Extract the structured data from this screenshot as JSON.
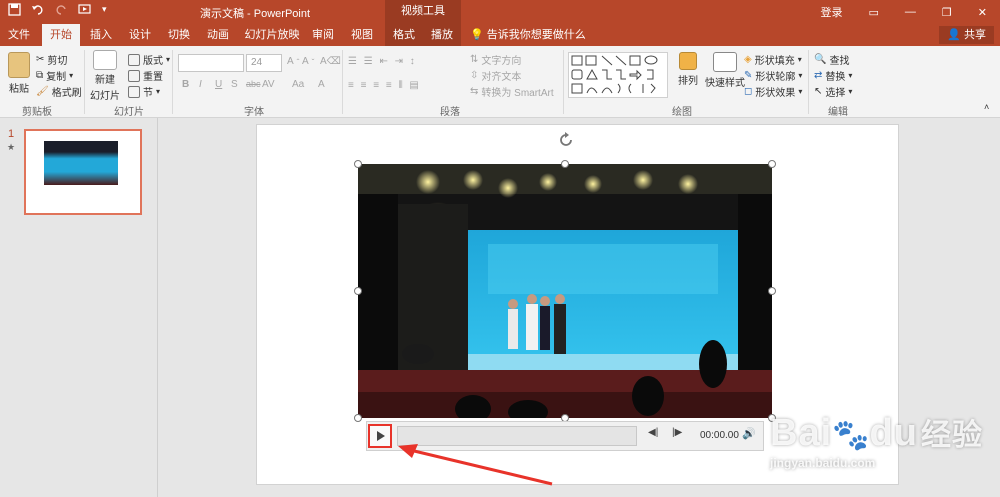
{
  "title_bar": {
    "doc_title": "演示文稿 - PowerPoint",
    "context_tools": "视频工具",
    "login": "登录",
    "window_controls": [
      "ribbon-display-icon",
      "minimize-icon",
      "restore-icon",
      "close-icon"
    ]
  },
  "tabs": [
    {
      "label": "文件"
    },
    {
      "label": "开始"
    },
    {
      "label": "插入"
    },
    {
      "label": "设计"
    },
    {
      "label": "切换"
    },
    {
      "label": "动画"
    },
    {
      "label": "幻灯片放映"
    },
    {
      "label": "审阅"
    },
    {
      "label": "视图"
    },
    {
      "label": "格式"
    },
    {
      "label": "播放"
    }
  ],
  "active_tab": "开始",
  "tell_me": "告诉我你想要做什么",
  "share": "共享",
  "ribbon": {
    "clipboard": {
      "paste": "粘贴",
      "cut": "剪切",
      "copy": "复制",
      "format_painter": "格式刷",
      "label": "剪贴板"
    },
    "slides": {
      "new_slide": "新建",
      "new_slide2": "幻灯片",
      "layout": "版式",
      "reset": "重置",
      "section": "节",
      "label": "幻灯片"
    },
    "font": {
      "size": "24",
      "label": "字体",
      "bold": "B",
      "italic": "I",
      "underline": "U",
      "strike": "S",
      "abc": "abc",
      "av": "AV",
      "aa": "Aa",
      "a_color": "A"
    },
    "paragraph": {
      "text_direction": "文字方向",
      "align_text": "对齐文本",
      "smartart": "转换为 SmartArt",
      "label": "段落"
    },
    "drawing": {
      "arrange": "排列",
      "quick_styles": "快速样式",
      "shape_fill": "形状填充",
      "shape_outline": "形状轮廓",
      "shape_effects": "形状效果",
      "label": "绘图"
    },
    "editing": {
      "find": "查找",
      "replace": "替换",
      "select": "选择",
      "label": "编辑"
    }
  },
  "slide_panel": {
    "slide_number": "1",
    "star": "★"
  },
  "player": {
    "time": "00:00.00"
  },
  "watermark": {
    "brand": "Bai",
    "brand2": "du",
    "cn": "经验",
    "url": "jingyan.baidu.com"
  }
}
